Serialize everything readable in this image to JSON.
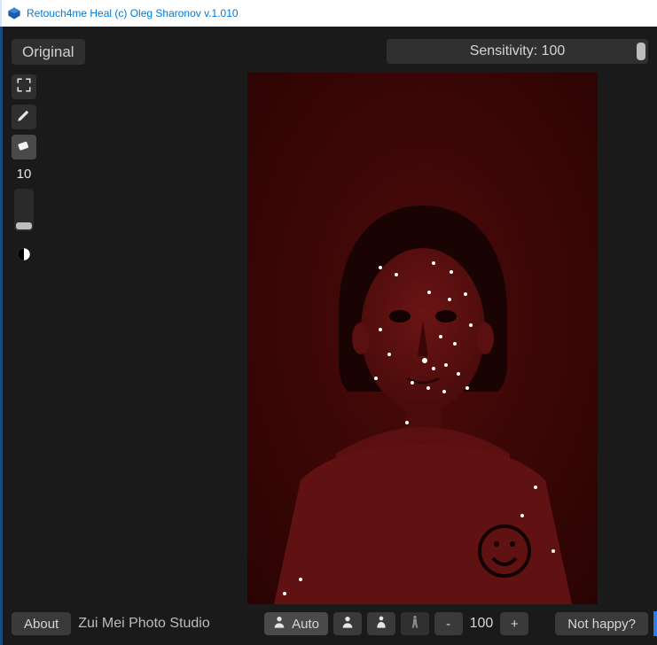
{
  "window": {
    "title": "Retouch4me Heal (c) Oleg Sharonov v.1.010"
  },
  "topbar": {
    "original_label": "Original",
    "sensitivity_label": "Sensitivity: 100"
  },
  "toolbar": {
    "brush_size": "10"
  },
  "bottombar": {
    "about_label": "About",
    "watermark": "Zui Mei Photo Studio",
    "auto_label": "Auto",
    "zoom_value": "100",
    "minus": "-",
    "plus": "+",
    "not_happy_label": "Not happy?"
  }
}
